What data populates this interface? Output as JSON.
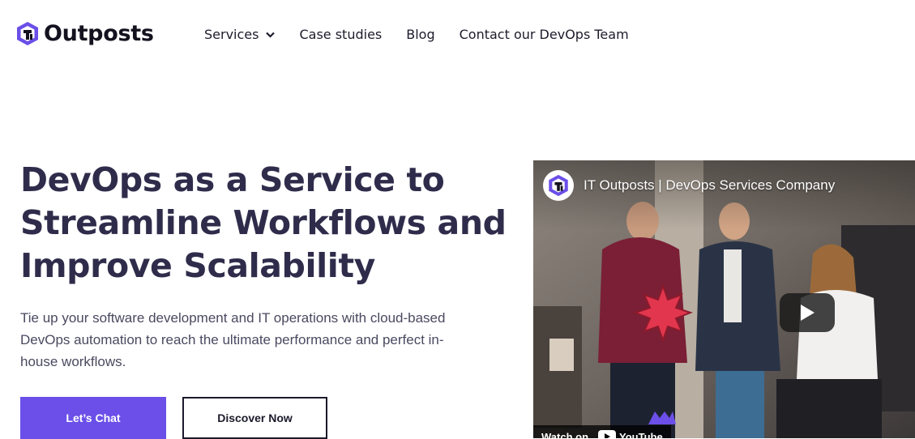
{
  "brand": {
    "name": "Outposts",
    "accent": "#6b4fe8"
  },
  "nav": {
    "items": [
      {
        "label": "Services",
        "has_dropdown": true
      },
      {
        "label": "Case studies"
      },
      {
        "label": "Blog"
      },
      {
        "label": "Contact our DevOps Team"
      }
    ]
  },
  "hero": {
    "title_lines": [
      "DevOps as a Service to",
      "Streamline Workflows and",
      "Improve Scalability"
    ],
    "description": "Tie up your software development and IT operations with cloud-based DevOps automation to reach the ultimate performance and perfect in-house workflows.",
    "primary_button": "Let’s Chat",
    "secondary_button": "Discover Now"
  },
  "video": {
    "title": "IT Outposts | DevOps Services Company",
    "watch_label": "Watch on",
    "platform": "YouTube",
    "icons": [
      "channel-logo-icon",
      "play-icon",
      "youtube-icon"
    ]
  }
}
